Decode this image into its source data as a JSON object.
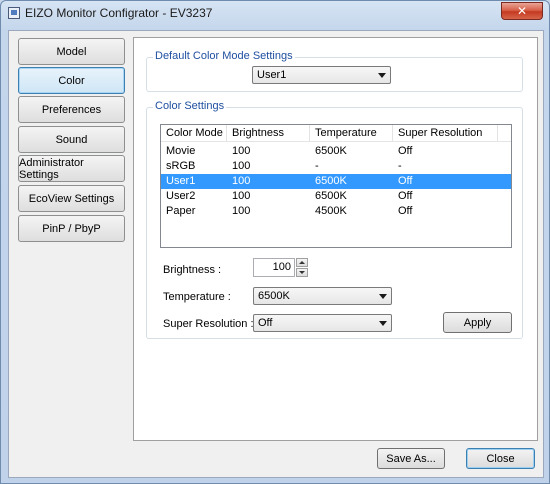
{
  "window": {
    "title": "EIZO Monitor Configrator - EV3237"
  },
  "nav": {
    "items": [
      {
        "label": "Model",
        "selected": false
      },
      {
        "label": "Color",
        "selected": true
      },
      {
        "label": "Preferences",
        "selected": false
      },
      {
        "label": "Sound",
        "selected": false
      },
      {
        "label": "Administrator Settings",
        "selected": false
      },
      {
        "label": "EcoView Settings",
        "selected": false
      },
      {
        "label": "PinP / PbyP",
        "selected": false
      }
    ]
  },
  "default_mode": {
    "group_title": "Default Color Mode Settings",
    "selected": "User1"
  },
  "color_settings": {
    "group_title": "Color Settings",
    "columns": [
      "Color Mode",
      "Brightness",
      "Temperature",
      "Super Resolution"
    ],
    "rows": [
      {
        "mode": "Movie",
        "brightness": "100",
        "temperature": "6500K",
        "super_resolution": "Off",
        "selected": false
      },
      {
        "mode": "sRGB",
        "brightness": "100",
        "temperature": "-",
        "super_resolution": "-",
        "selected": false
      },
      {
        "mode": "User1",
        "brightness": "100",
        "temperature": "6500K",
        "super_resolution": "Off",
        "selected": true
      },
      {
        "mode": "User2",
        "brightness": "100",
        "temperature": "6500K",
        "super_resolution": "Off",
        "selected": false
      },
      {
        "mode": "Paper",
        "brightness": "100",
        "temperature": "4500K",
        "super_resolution": "Off",
        "selected": false
      }
    ],
    "brightness_label": "Brightness :",
    "brightness_value": "100",
    "temperature_label": "Temperature :",
    "temperature_value": "6500K",
    "super_resolution_label": "Super Resolution :",
    "super_resolution_value": "Off",
    "apply_label": "Apply"
  },
  "footer": {
    "save_as_label": "Save As...",
    "close_label": "Close"
  },
  "colors": {
    "selection": "#3399ff",
    "group_title": "#1f4fa0",
    "close_button": "#c53a22"
  }
}
